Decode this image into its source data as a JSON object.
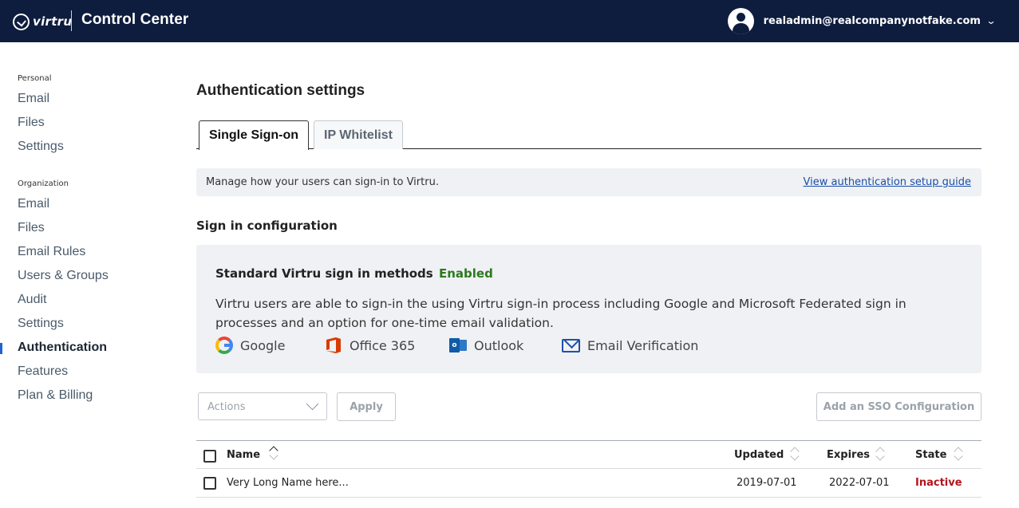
{
  "header": {
    "logo_text": "virtru",
    "app_title": "Control Center",
    "user_email": "realadmin@realcompanynotfake.com"
  },
  "sidebar": {
    "personal_label": "Personal",
    "personal_items": [
      "Email",
      "Files",
      "Settings"
    ],
    "organization_label": "Organization",
    "organization_items": [
      "Email",
      "Files",
      "Email Rules",
      "Users & Groups",
      "Audit",
      "Settings",
      "Authentication",
      "Features",
      "Plan & Billing"
    ],
    "active_item": "Authentication"
  },
  "page": {
    "title": "Authentication settings",
    "tabs": [
      {
        "label": "Single Sign-on",
        "active": true
      },
      {
        "label": "IP Whitelist",
        "active": false
      }
    ],
    "info_text": "Manage how your users can sign-in to Virtru.",
    "info_link": "View authentication setup guide",
    "section_title": "Sign in configuration"
  },
  "config": {
    "title": "Standard Virtru sign in methods",
    "status": "Enabled",
    "description": "Virtru users are able to sign-in the using Virtru sign-in process including Google and Microsoft Federated sign in processes and an option for one-time email validation.",
    "methods": [
      {
        "label": "Google",
        "icon": "google-icon"
      },
      {
        "label": "Office 365",
        "icon": "office365-icon"
      },
      {
        "label": "Outlook",
        "icon": "outlook-icon"
      },
      {
        "label": "Email Verification",
        "icon": "envelope-icon"
      }
    ]
  },
  "controls": {
    "actions_placeholder": "Actions",
    "apply_label": "Apply",
    "add_sso_label": "Add an SSO Configuration"
  },
  "table": {
    "columns": [
      "Name",
      "Updated",
      "Expires",
      "State"
    ],
    "rows": [
      {
        "name": "Very Long Name here...",
        "updated": "2019-07-01",
        "expires": "2022-07-01",
        "state": "Inactive"
      }
    ]
  },
  "colors": {
    "header_bg": "#0e1c3e",
    "enabled": "#2b7a1e",
    "inactive": "#b3151d",
    "link": "#1a4fa8",
    "panel_bg": "#eff1f4"
  }
}
